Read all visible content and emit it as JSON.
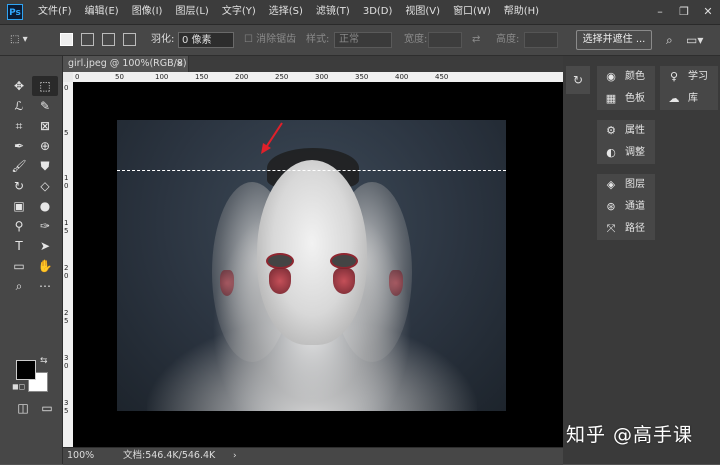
{
  "app": {
    "logo_text": "Ps"
  },
  "menu": [
    "文件(F)",
    "编辑(E)",
    "图像(I)",
    "图层(L)",
    "文字(Y)",
    "选择(S)",
    "滤镜(T)",
    "3D(D)",
    "视图(V)",
    "窗口(W)",
    "帮助(H)"
  ],
  "window_controls": {
    "minimize": "–",
    "restore": "❐",
    "close": "✕"
  },
  "options": {
    "feather_label": "羽化:",
    "feather_value": "0 像素",
    "antialias_label": "消除锯齿",
    "style_label": "样式:",
    "style_value": "正常",
    "width_label": "宽度:",
    "height_label": "高度:",
    "mask_button": "选择并遮住 ..."
  },
  "document": {
    "tab_title": "girl.jpeg @ 100%(RGB/8)",
    "tab_close": "×",
    "zoom": "100%",
    "doc_size": "文档:546.4K/546.4K"
  },
  "rulers": {
    "h": [
      "0",
      "50",
      "100",
      "150",
      "200",
      "250",
      "300",
      "350",
      "400",
      "450"
    ],
    "v": [
      "0",
      "5",
      "1 0",
      "1 5",
      "2 0",
      "2 5",
      "3 0",
      "3 5"
    ]
  },
  "tools": [
    {
      "icon": "✥",
      "name": "move-tool"
    },
    {
      "icon": "⬚",
      "name": "marquee-tool",
      "active": true
    },
    {
      "icon": "ℒ",
      "name": "lasso-tool"
    },
    {
      "icon": "✎",
      "name": "quick-select-tool"
    },
    {
      "icon": "⌗",
      "name": "crop-tool"
    },
    {
      "icon": "⊠",
      "name": "frame-tool"
    },
    {
      "icon": "✒",
      "name": "eyedropper-tool"
    },
    {
      "icon": "⊕",
      "name": "spot-heal-tool"
    },
    {
      "icon": "🖌",
      "name": "brush-tool"
    },
    {
      "icon": "⛊",
      "name": "stamp-tool"
    },
    {
      "icon": "↻",
      "name": "history-brush-tool"
    },
    {
      "icon": "◇",
      "name": "eraser-tool"
    },
    {
      "icon": "▣",
      "name": "gradient-tool"
    },
    {
      "icon": "●",
      "name": "blur-tool"
    },
    {
      "icon": "⚲",
      "name": "dodge-tool"
    },
    {
      "icon": "✑",
      "name": "pen-tool"
    },
    {
      "icon": "T",
      "name": "type-tool"
    },
    {
      "icon": "➤",
      "name": "path-select-tool"
    },
    {
      "icon": "▭",
      "name": "shape-tool"
    },
    {
      "icon": "✋",
      "name": "hand-tool"
    },
    {
      "icon": "⌕",
      "name": "zoom-tool"
    },
    {
      "icon": "⋯",
      "name": "more-tools"
    }
  ],
  "panels_col1": [
    {
      "icon": "◉",
      "label": "颜色",
      "name": "color-panel"
    },
    {
      "icon": "▦",
      "label": "色板",
      "name": "swatches-panel"
    },
    {
      "icon": "⚙",
      "label": "属性",
      "name": "properties-panel"
    },
    {
      "icon": "◐",
      "label": "调整",
      "name": "adjustments-panel"
    },
    {
      "icon": "◈",
      "label": "图层",
      "name": "layers-panel"
    },
    {
      "icon": "⊛",
      "label": "通道",
      "name": "channels-panel"
    },
    {
      "icon": "⤧",
      "label": "路径",
      "name": "paths-panel"
    }
  ],
  "panels_col2": [
    {
      "icon": "♀",
      "label": "学习",
      "name": "learn-panel"
    },
    {
      "icon": "☁",
      "label": "库",
      "name": "libraries-panel"
    }
  ],
  "watermark": "知乎 @高手课",
  "colors": {
    "accent": "#31a8ff",
    "arrow": "#e0202a"
  }
}
